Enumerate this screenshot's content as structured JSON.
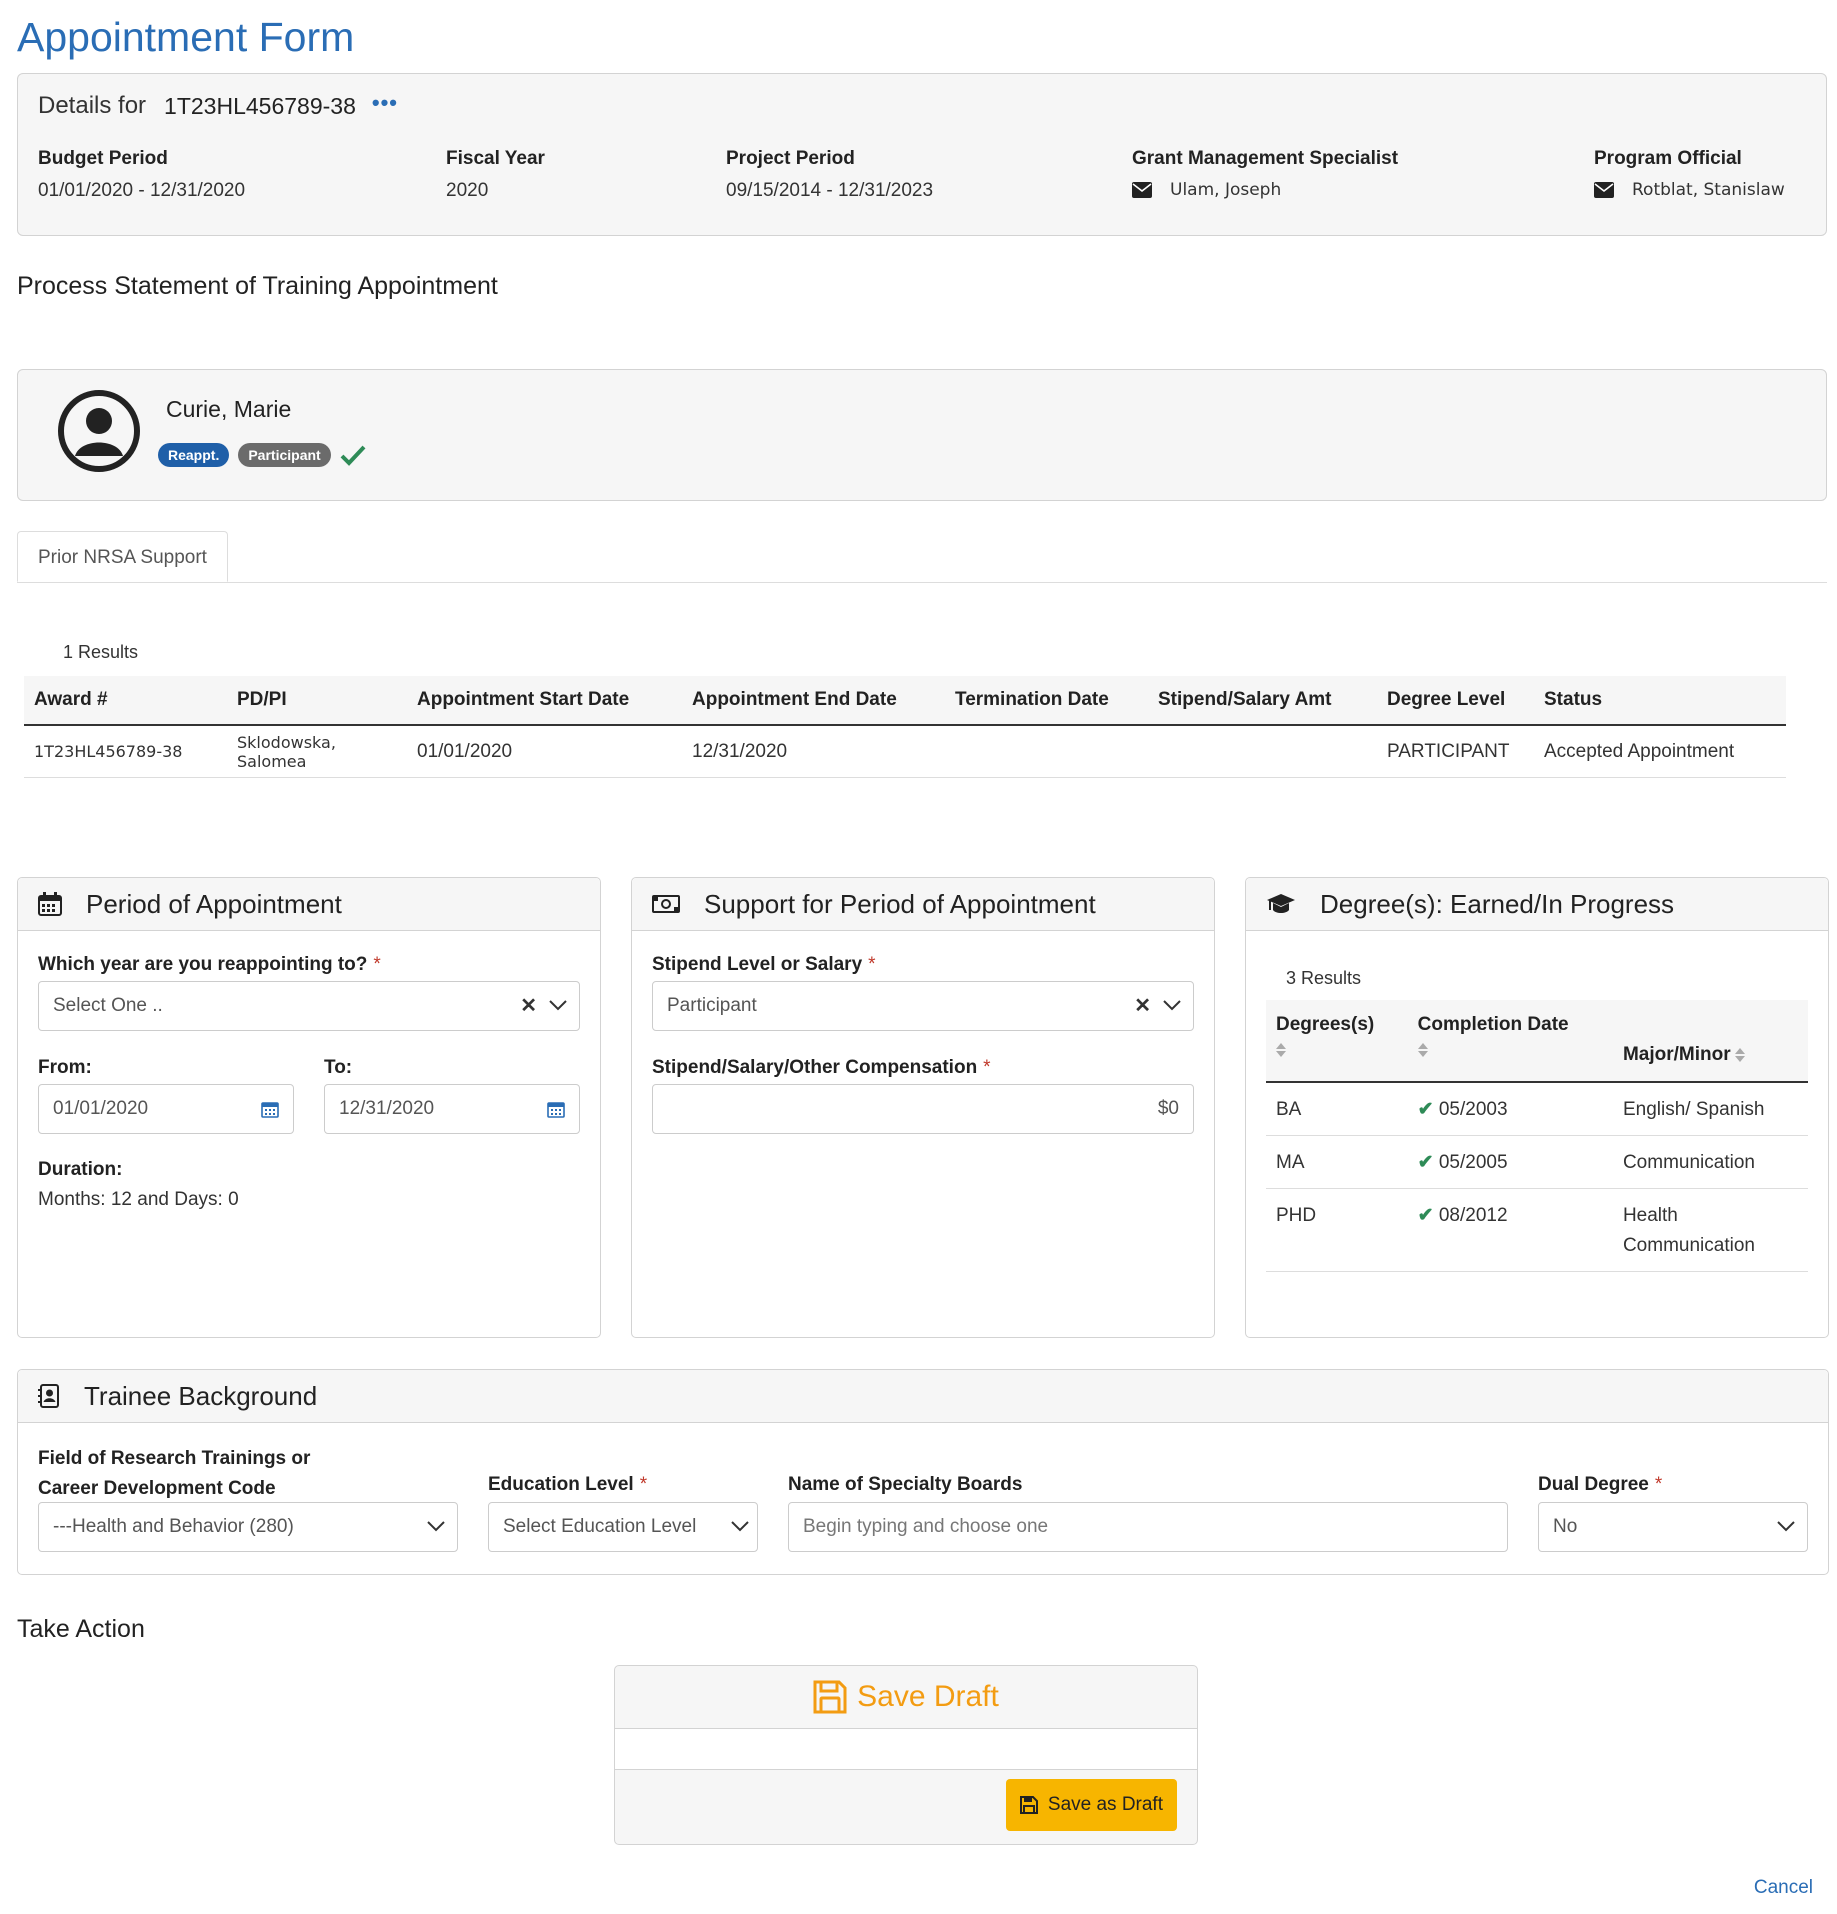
{
  "page_title": "Appointment Form",
  "details": {
    "label": "Details for",
    "grant_id": "1T23HL456789-38",
    "more": "•••",
    "columns": [
      {
        "label": "Budget Period",
        "value": "01/01/2020 - 12/31/2020"
      },
      {
        "label": "Fiscal Year",
        "value": "2020"
      },
      {
        "label": "Project Period",
        "value": "09/15/2014 - 12/31/2023"
      },
      {
        "label": "Grant Management Specialist",
        "value": "Ulam, Joseph"
      },
      {
        "label": "Program Official",
        "value": "Rotblat, Stanislaw"
      }
    ]
  },
  "process_title": "Process Statement of Training Appointment",
  "person": {
    "name": "Curie, Marie",
    "badge_reappt": "Reappt.",
    "badge_participant": "Participant"
  },
  "tabs": [
    {
      "label": "Prior NRSA Support"
    }
  ],
  "prior": {
    "results": "1 Results",
    "headers": [
      "Award #",
      "PD/PI",
      "Appointment Start Date",
      "Appointment End Date",
      "Termination Date",
      "Stipend/Salary Amt",
      "Degree Level",
      "Status"
    ],
    "rows": [
      [
        "1T23HL456789-38",
        "Sklodowska, Salomea",
        "01/01/2020",
        "12/31/2020",
        "",
        "",
        "PARTICIPANT",
        "Accepted Appointment"
      ]
    ]
  },
  "period": {
    "title": "Period of Appointment",
    "year_label": "Which year are you reappointing to?",
    "year_placeholder": "Select One ..",
    "from_label": "From:",
    "from_value": "01/01/2020",
    "to_label": "To:",
    "to_value": "12/31/2020",
    "duration_label": "Duration:",
    "duration_value": "Months: 12 and Days: 0"
  },
  "support": {
    "title": "Support for Period of Appointment",
    "stipend_label": "Stipend Level or Salary",
    "stipend_value": "Participant",
    "comp_label": "Stipend/Salary/Other Compensation",
    "comp_value": "$0"
  },
  "degrees": {
    "title": "Degree(s): Earned/In Progress",
    "results": "3 Results",
    "headers": [
      "Degrees(s)",
      "Completion Date",
      "Major/Minor"
    ],
    "rows": [
      {
        "degree": "BA",
        "date": "05/2003",
        "major": "English/ Spanish"
      },
      {
        "degree": "MA",
        "date": "05/2005",
        "major": "Communication"
      },
      {
        "degree": "PHD",
        "date": "08/2012",
        "major": "Health Communication"
      }
    ]
  },
  "background": {
    "title": "Trainee Background",
    "field_label": "Field of Research Trainings or Career Development Code",
    "field_value": "---Health and Behavior (280)",
    "edu_label": "Education Level",
    "edu_value": "Select Education Level",
    "boards_label": "Name of Specialty Boards",
    "boards_placeholder": "Begin typing and choose one",
    "dual_label": "Dual Degree",
    "dual_value": "No"
  },
  "action": {
    "title": "Take Action",
    "save_draft_title": "Save Draft",
    "save_button": "Save as Draft",
    "cancel": "Cancel"
  },
  "colors": {
    "brand_blue": "#2a6db5",
    "warning": "#f7b500",
    "success": "#2e8b57",
    "save_orange": "#f39c12"
  }
}
